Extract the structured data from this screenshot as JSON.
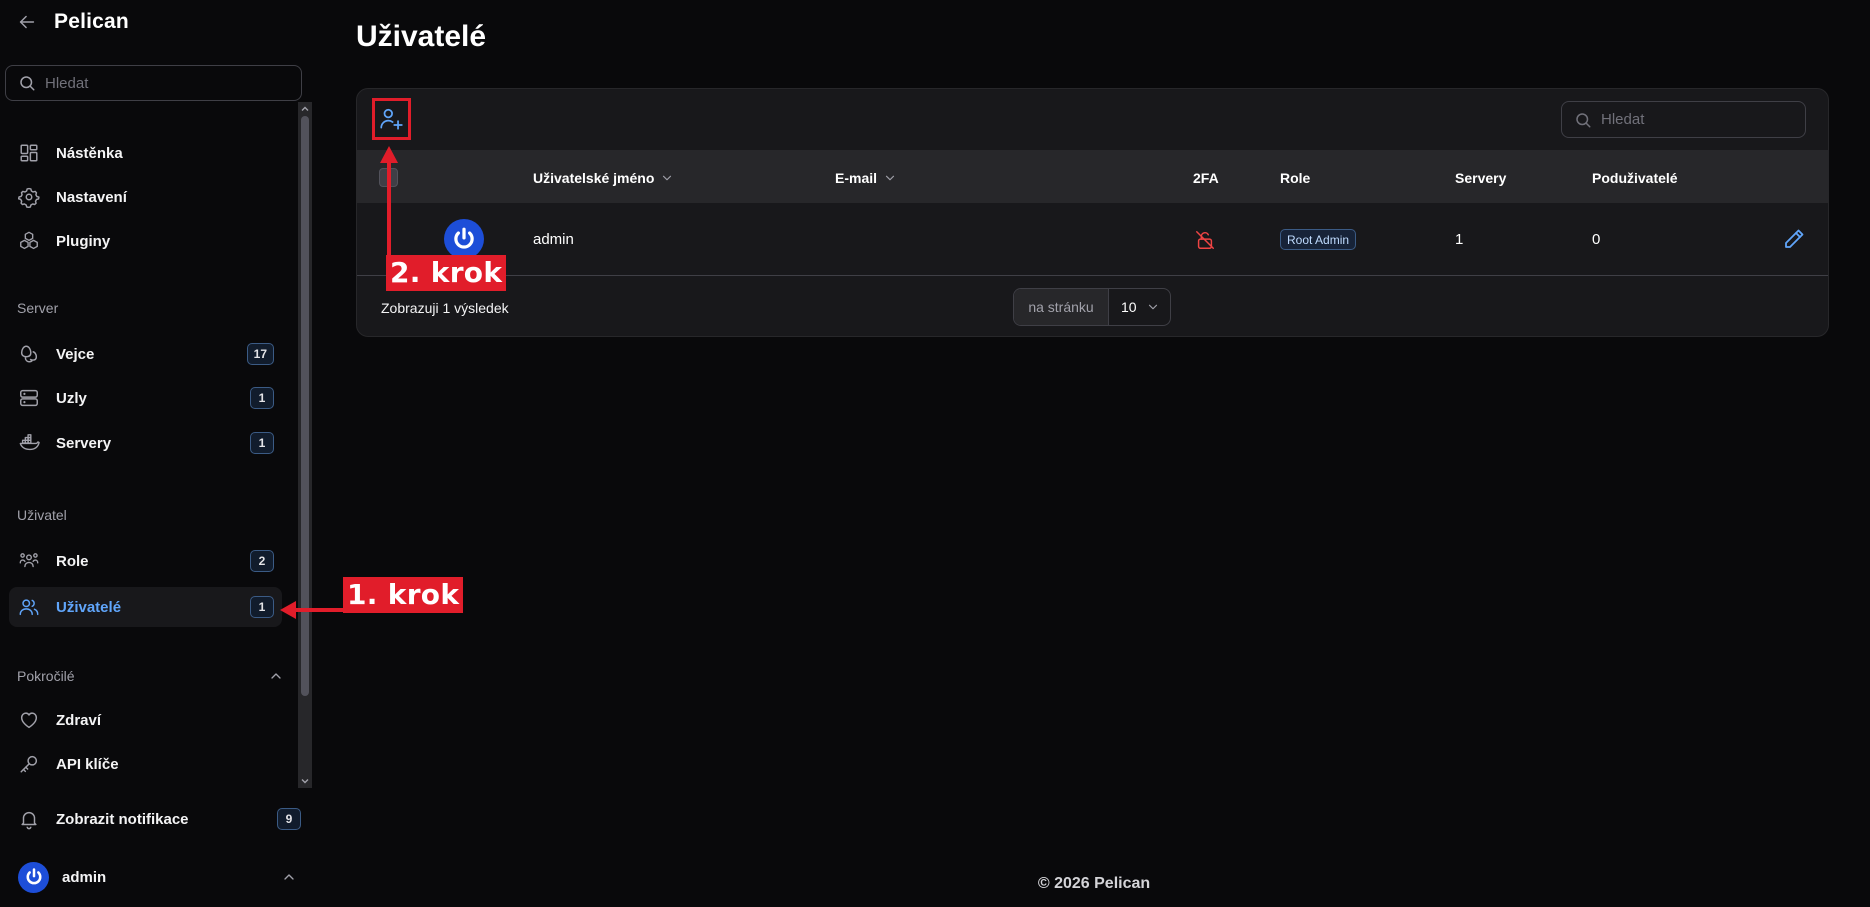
{
  "app": {
    "name": "Pelican"
  },
  "sidebar": {
    "search_placeholder": "Hledat",
    "top_items": [
      {
        "label": "Nástěnka",
        "icon": "dashboard-icon"
      },
      {
        "label": "Nastavení",
        "icon": "gear-icon"
      },
      {
        "label": "Pluginy",
        "icon": "cubes-icon"
      }
    ],
    "groups": {
      "server": {
        "label": "Server",
        "items": [
          {
            "label": "Vejce",
            "count": "17",
            "icon": "egg-icon"
          },
          {
            "label": "Uzly",
            "count": "1",
            "icon": "server-stack-icon"
          },
          {
            "label": "Servery",
            "count": "1",
            "icon": "docker-icon"
          }
        ]
      },
      "user": {
        "label": "Uživatel",
        "items": [
          {
            "label": "Role",
            "count": "2",
            "icon": "users-group-icon"
          },
          {
            "label": "Uživatelé",
            "count": "1",
            "icon": "users-icon",
            "active": true
          }
        ]
      },
      "advanced": {
        "label": "Pokročilé",
        "items": [
          {
            "label": "Zdraví",
            "icon": "heart-icon"
          },
          {
            "label": "API klíče",
            "icon": "key-icon"
          }
        ]
      }
    },
    "notifications": {
      "label": "Zobrazit notifikace",
      "count": "9"
    },
    "user_menu": {
      "name": "admin"
    }
  },
  "page": {
    "title": "Uživatelé"
  },
  "table": {
    "search_placeholder": "Hledat",
    "columns": {
      "username": "Uživatelské jméno",
      "email": "E-mail",
      "twofa": "2FA",
      "role": "Role",
      "servers": "Servery",
      "subusers": "Poduživatelé"
    },
    "rows": [
      {
        "username": "admin",
        "email": "",
        "twofa": "disabled",
        "role": "Root Admin",
        "servers": "1",
        "subusers": "0"
      }
    ],
    "result_text": "Zobrazuji 1 výsledek",
    "per_page_label": "na stránku",
    "per_page_value": "10"
  },
  "annotations": {
    "step1": "1. krok",
    "step2": "2. krok",
    "color": "#e11d2a"
  },
  "footer": {
    "text": "© 2026 Pelican"
  },
  "colors": {
    "accent": "#60a5fa",
    "background": "#09090b",
    "danger": "#ef4444"
  }
}
